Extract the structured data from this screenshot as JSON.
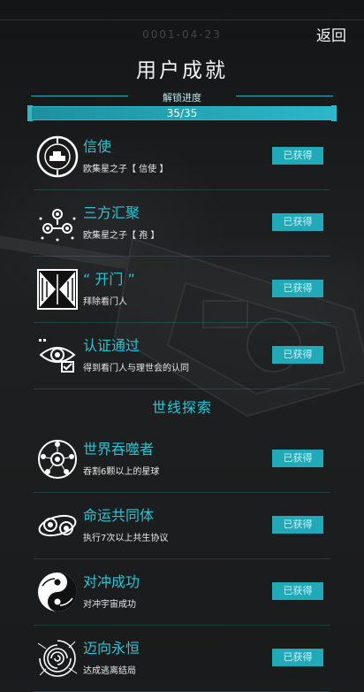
{
  "header": {
    "date": "0001-04-23",
    "back_label": "返回",
    "title": "用户成就"
  },
  "progress": {
    "label": "解锁进度",
    "text": "35/35",
    "fraction": 1.0
  },
  "colors": {
    "accent": "#2bc4d4",
    "badge_bg": "#22a9b8",
    "background": "#1b1c1d"
  },
  "section_title": "世线探索",
  "achievements_a": [
    {
      "name": "信使",
      "desc": "欧集星之子【 信使 】",
      "status": "已获得",
      "icon": "ship-emblem-icon"
    },
    {
      "name": "三方汇聚",
      "desc": "欧集星之子【 孢 】",
      "status": "已获得",
      "icon": "network-nodes-icon"
    },
    {
      "name": "“ 开门 ”",
      "desc": "拜除看门人",
      "status": "已获得",
      "icon": "gate-icon"
    },
    {
      "name": "认证通过",
      "desc": "得到看门人与理世会的认同",
      "status": "已获得",
      "icon": "eye-verify-icon"
    }
  ],
  "achievements_b": [
    {
      "name": "世界吞噬者",
      "desc": "吞割6颗以上的星球",
      "status": "已获得",
      "icon": "planet-devourer-icon"
    },
    {
      "name": "命运共同体",
      "desc": "执行7次以上共生协议",
      "status": "已获得",
      "icon": "orbit-pair-icon"
    },
    {
      "name": "对冲成功",
      "desc": "对冲宇宙成功",
      "status": "已获得",
      "icon": "yin-yang-swirl-icon"
    },
    {
      "name": "迈向永恒",
      "desc": "达成逃离结局",
      "status": "已获得",
      "icon": "vortex-icon"
    }
  ]
}
